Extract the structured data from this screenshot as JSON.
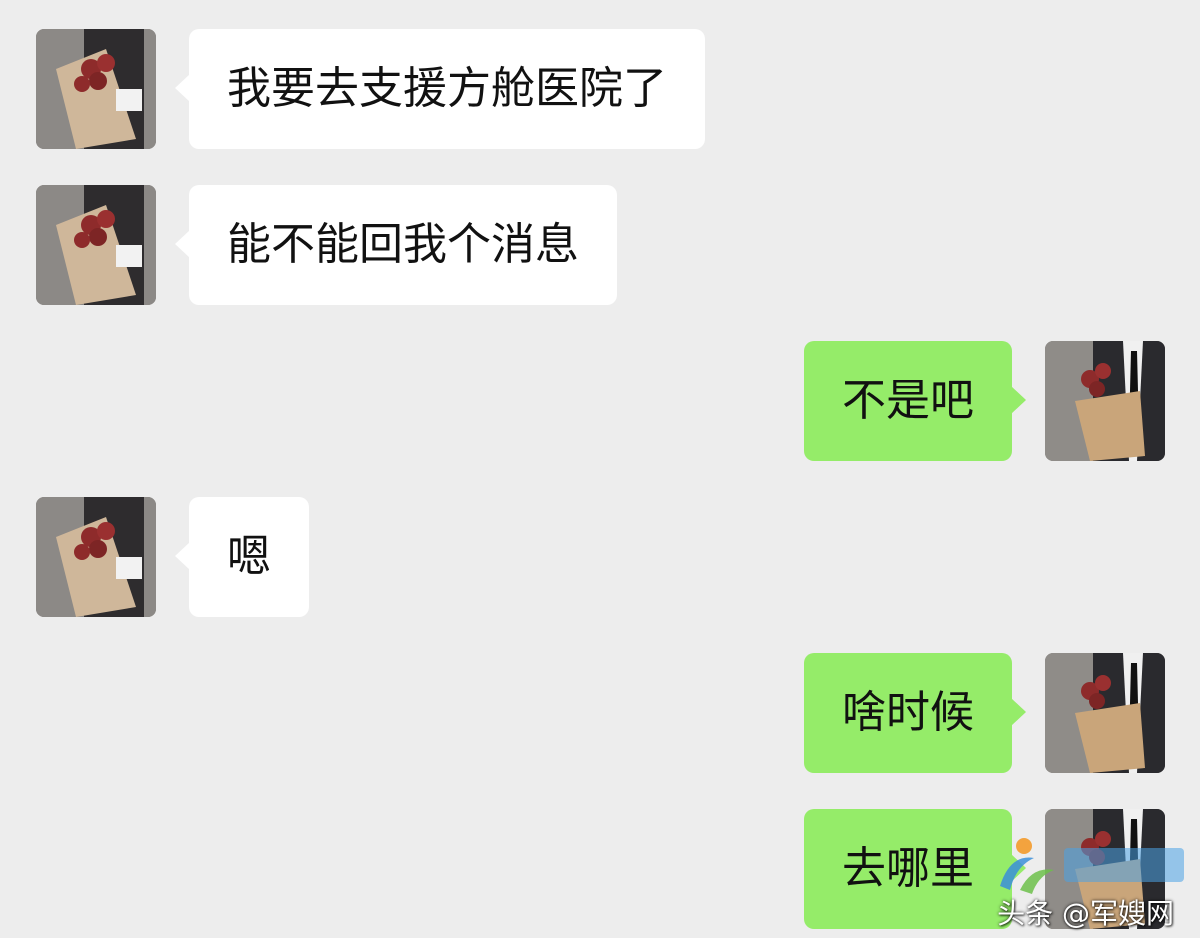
{
  "messages": [
    {
      "side": "left",
      "text": "我要去支援方舱医院了"
    },
    {
      "side": "left",
      "text": "能不能回我个消息"
    },
    {
      "side": "right",
      "text": "不是吧"
    },
    {
      "side": "left",
      "text": "嗯"
    },
    {
      "side": "right",
      "text": "啥时候"
    },
    {
      "side": "right",
      "text": "去哪里"
    }
  ],
  "watermark": {
    "text": "头条 @军嫂网"
  },
  "colors": {
    "background": "#ededed",
    "left_bubble": "#ffffff",
    "right_bubble": "#95ec69"
  },
  "icons": {
    "left_avatar": "avatar-bouquet-icon",
    "right_avatar": "avatar-suit-bouquet-icon"
  }
}
